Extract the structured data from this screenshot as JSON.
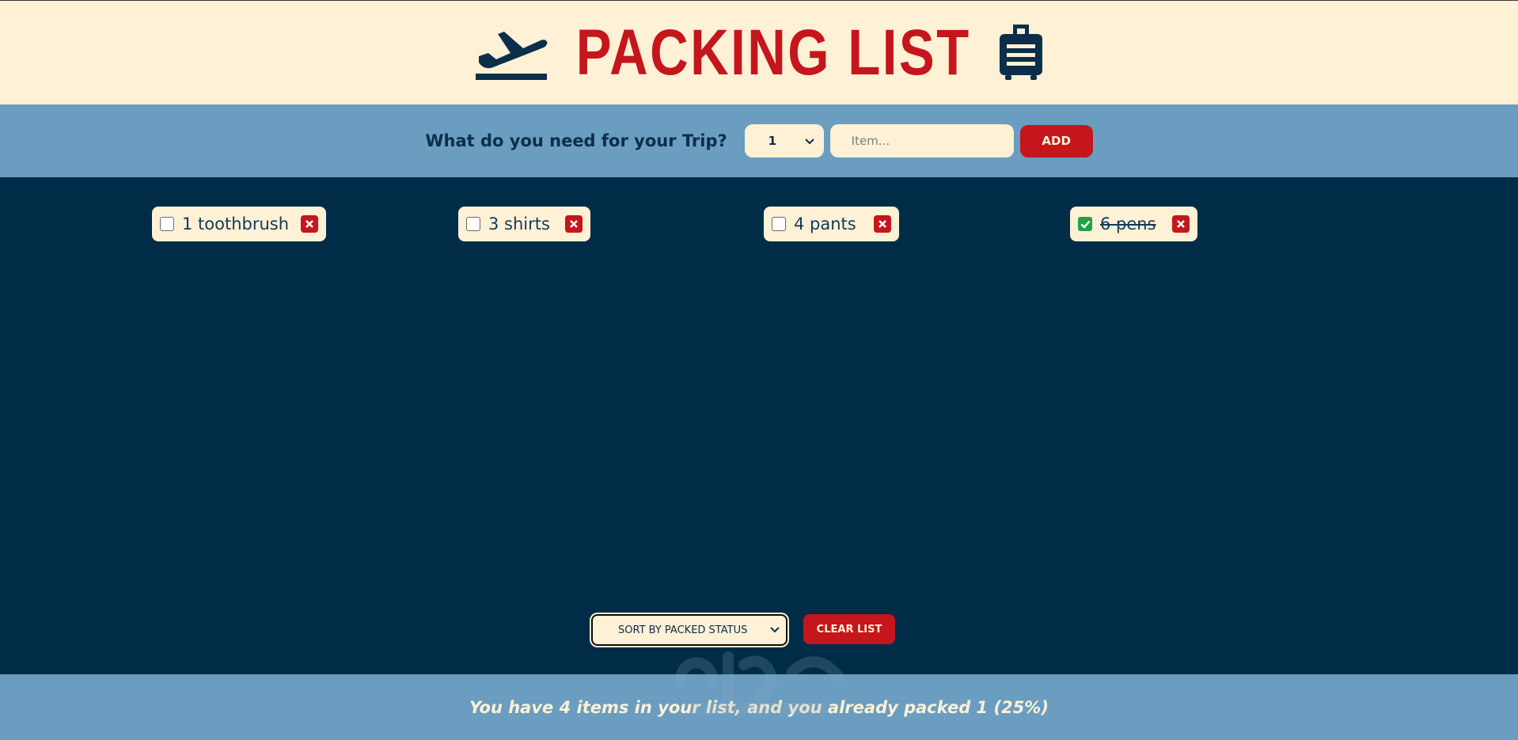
{
  "header": {
    "title": "PACKING LIST",
    "left_icon": "airplane-departure-icon",
    "right_icon": "suitcase-icon",
    "colors": {
      "background": "#fff1d6",
      "title": "#c4161c",
      "icon": "#0b2e4a"
    }
  },
  "form": {
    "question": "What do you need for your Trip?",
    "quantity_value": "1",
    "item_placeholder": "Item...",
    "add_label": "ADD"
  },
  "items": [
    {
      "text": "1 toothbrush",
      "packed": false
    },
    {
      "text": "3 shirts",
      "packed": false
    },
    {
      "text": "4 pants",
      "packed": false
    },
    {
      "text": "6 pens",
      "packed": true
    }
  ],
  "actions": {
    "sort_value": "SORT BY PACKED STATUS",
    "clear_label": "CLEAR LIST"
  },
  "footer": {
    "stats": "You have 4 items in your list, and you already packed 1 (25%)"
  },
  "colors": {
    "list_background": "#002c47",
    "bar_background": "#6a9dc0",
    "accent_red": "#c4161c",
    "cream": "#fff1d6",
    "checked_green": "#1fa24a"
  }
}
